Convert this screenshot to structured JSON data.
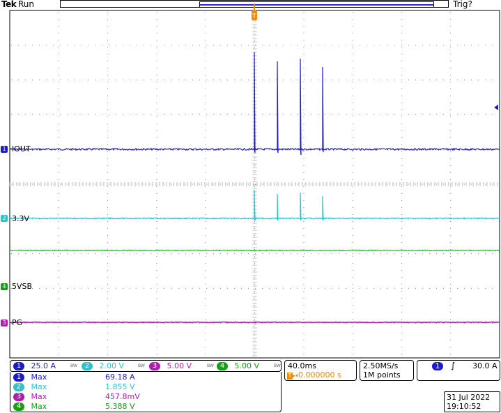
{
  "header": {
    "brand": "Tek",
    "run_state": "Run",
    "trigger_state": "Trig?"
  },
  "colors": {
    "ch1": "#1c1cc4",
    "ch2": "#2bc4cc",
    "ch3": "#b01cb0",
    "ch4": "#14a014",
    "trace5v": "#22c022",
    "orange": "#f08c00"
  },
  "channels": [
    {
      "num": "1",
      "label": "IOUT",
      "scale": "25.0 A",
      "color": "#1c1cc4"
    },
    {
      "num": "2",
      "label": "3.3V",
      "scale": "2.00 V",
      "color": "#2bc4cc"
    },
    {
      "num": "3",
      "label": "PG",
      "scale": "5.00 V",
      "color": "#b01cb0"
    },
    {
      "num": "4",
      "label": "5VSB",
      "scale": "5.00 V",
      "color": "#14a014"
    }
  ],
  "trigger_marker": "T",
  "horizontal": {
    "timebase": "40.0ms",
    "trigger_pos_symbol": "T",
    "trigger_pos_arrow": "▸▾",
    "delay": "0.000000 s"
  },
  "acquisition": {
    "sample_rate": "2.50MS/s",
    "record_length": "1M points"
  },
  "trigger": {
    "source": "1",
    "slope_icon": "rising-edge",
    "slope_glyph": "∫",
    "level": "30.0 A"
  },
  "measurements": [
    {
      "num": "1",
      "type": "Max",
      "value": "69.18 A",
      "color": "#1c1cc4"
    },
    {
      "num": "2",
      "type": "Max",
      "value": "1.855 V",
      "color": "#2bc4cc"
    },
    {
      "num": "3",
      "type": "Max",
      "value": "457.8mV",
      "color": "#b01cb0"
    },
    {
      "num": "4",
      "type": "Max",
      "value": "5.388 V",
      "color": "#14a014"
    }
  ],
  "bw_mark": "BW",
  "datetime": {
    "date": "31 Jul  2022",
    "time": "19:10:52"
  }
}
